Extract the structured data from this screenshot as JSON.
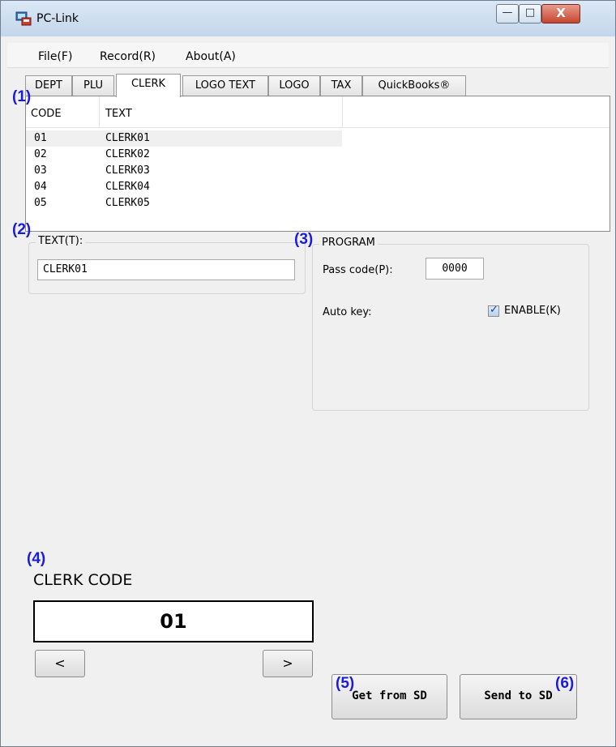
{
  "window": {
    "title": "PC-Link",
    "minimize_glyph": "—",
    "maximize_glyph": "□",
    "close_glyph": "X"
  },
  "menu": {
    "items": [
      "File(F)",
      "Record(R)",
      "About(A)"
    ]
  },
  "tabs": [
    "DEPT",
    "PLU",
    "CLERK",
    "LOGO TEXT",
    "LOGO",
    "TAX",
    "QuickBooks®"
  ],
  "active_tab": "CLERK",
  "table": {
    "headers": [
      "CODE",
      "TEXT"
    ],
    "rows": [
      {
        "code": "01",
        "text": "CLERK01"
      },
      {
        "code": "02",
        "text": "CLERK02"
      },
      {
        "code": "03",
        "text": "CLERK03"
      },
      {
        "code": "04",
        "text": "CLERK04"
      },
      {
        "code": "05",
        "text": "CLERK05"
      }
    ]
  },
  "text_group": {
    "title": "TEXT(T):",
    "value": "CLERK01"
  },
  "program_group": {
    "title": "PROGRAM",
    "passcode_label": "Pass code(P):",
    "passcode_value": "0000",
    "autokey_label": "Auto key:",
    "enable_label": "ENABLE(K)",
    "enable_checked": true
  },
  "clerk_code": {
    "title": "CLERK CODE",
    "value": "01",
    "prev_glyph": "<",
    "next_glyph": ">"
  },
  "buttons": {
    "get": "Get from SD",
    "send": "Send to SD"
  },
  "markers": [
    "(1)",
    "(2)",
    "(3)",
    "(4)",
    "(5)",
    "(6)"
  ],
  "icons": [
    "app-icon",
    "minimize-icon",
    "maximize-icon",
    "close-icon",
    "checkbox-check-icon"
  ],
  "colors": {
    "marker": "#1c1cd8",
    "titlebar": "#c3d6ea",
    "close_button": "#c4462f"
  }
}
